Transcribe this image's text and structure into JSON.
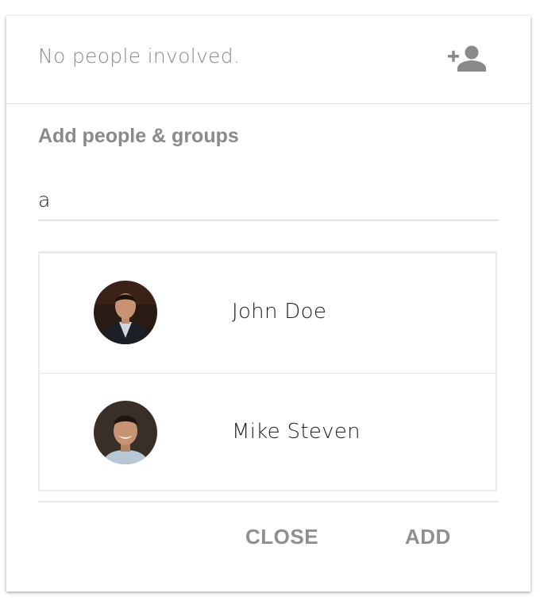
{
  "header": {
    "status_text": "No people involved.",
    "add_person_icon": "add-person-icon"
  },
  "picker": {
    "title": "Add people & groups",
    "search_value": "a"
  },
  "results": [
    {
      "name": "John Doe",
      "avatar_icon": "avatar"
    },
    {
      "name": "Mike Steven",
      "avatar_icon": "avatar"
    }
  ],
  "footer": {
    "close_label": "CLOSE",
    "add_label": "ADD"
  },
  "colors": {
    "muted_text": "#8a8a8a",
    "primary_text": "#222222",
    "divider": "#e2e2e2"
  }
}
